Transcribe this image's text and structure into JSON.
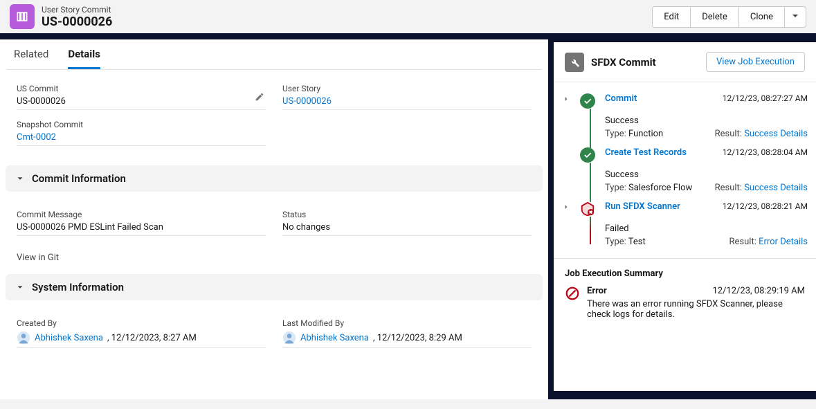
{
  "header": {
    "type_label": "User Story Commit",
    "record_title": "US-0000026",
    "actions": {
      "edit": "Edit",
      "delete": "Delete",
      "clone": "Clone"
    }
  },
  "tabs": {
    "related": "Related",
    "details": "Details"
  },
  "fields": {
    "us_commit": {
      "label": "US Commit",
      "value": "US-0000026"
    },
    "user_story": {
      "label": "User Story",
      "value": "US-0000026"
    },
    "snapshot_commit": {
      "label": "Snapshot Commit",
      "value": "Cmt-0002"
    }
  },
  "sections": {
    "commit_info": "Commit Information",
    "system_info": "System Information"
  },
  "commit_info": {
    "commit_message": {
      "label": "Commit Message",
      "value": "US-0000026 PMD ESLint Failed Scan"
    },
    "status": {
      "label": "Status",
      "value": "No changes"
    },
    "view_in_git": "View in Git"
  },
  "system_info": {
    "created_by": {
      "label": "Created By",
      "user": "Abhishek Saxena",
      "datetime": ", 12/12/2023, 8:27 AM"
    },
    "last_modified_by": {
      "label": "Last Modified By",
      "user": "Abhishek Saxena",
      "datetime": ", 12/12/2023, 8:29 AM"
    }
  },
  "right": {
    "title": "SFDX Commit",
    "view_btn": "View Job Execution",
    "steps": [
      {
        "title": "Commit",
        "time": "12/12/23, 08:27:27 AM",
        "status": "Success",
        "type_label": "Type:",
        "type_value": "Function",
        "result_label": "Result:",
        "result_link": "Success Details",
        "state": "success"
      },
      {
        "title": "Create Test Records",
        "time": "12/12/23, 08:28:04 AM",
        "status": "Success",
        "type_label": "Type:",
        "type_value": "Salesforce Flow",
        "result_label": "Result:",
        "result_link": "Success Details",
        "state": "success"
      },
      {
        "title": "Run SFDX Scanner",
        "time": "12/12/23, 08:28:21 AM",
        "status": "Failed",
        "type_label": "Type:",
        "type_value": "Test",
        "result_label": "Result:",
        "result_link": "Error Details",
        "state": "error"
      }
    ],
    "summary": {
      "title": "Job Execution Summary",
      "error_label": "Error",
      "time": "12/12/23, 08:29:19 AM",
      "message": "There was an error running SFDX Scanner, please check logs for details."
    }
  }
}
